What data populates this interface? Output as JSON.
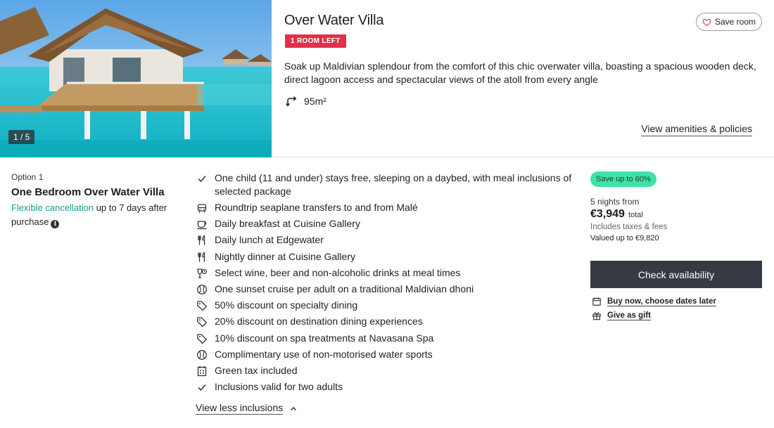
{
  "room": {
    "title": "Over Water Villa",
    "badge": "1 ROOM LEFT",
    "save_label": "Save room",
    "description": "Soak up Maldivian splendour from the comfort of this chic overwater villa, boasting a spacious wooden deck, direct lagoon access and spectacular views of the atoll from every angle",
    "size": "95m²",
    "view_amenities": "View amenities & policies",
    "image_counter": "1 / 5"
  },
  "option": {
    "label": "Option 1",
    "name": "One Bedroom Over Water Villa",
    "flex_link": "Flexible cancellation",
    "flex_rest": " up to 7 days after purchase"
  },
  "inclusions": [
    {
      "icon": "check-icon",
      "text": "One child (11 and under) stays free, sleeping on a daybed, with meal inclusions of selected package"
    },
    {
      "icon": "transfer-icon",
      "text": "Roundtrip seaplane transfers to and from Malé"
    },
    {
      "icon": "breakfast-icon",
      "text": "Daily breakfast at Cuisine Gallery"
    },
    {
      "icon": "cutlery-icon",
      "text": "Daily lunch at Edgewater"
    },
    {
      "icon": "cutlery-icon",
      "text": "Nightly dinner at Cuisine Gallery"
    },
    {
      "icon": "drinks-icon",
      "text": "Select wine, beer and non-alcoholic drinks at meal times"
    },
    {
      "icon": "activity-icon",
      "text": "One sunset cruise per adult on a traditional Maldivian dhoni"
    },
    {
      "icon": "tag-icon",
      "text": "50% discount on specialty dining"
    },
    {
      "icon": "tag-icon",
      "text": "20% discount on destination dining experiences"
    },
    {
      "icon": "tag-icon",
      "text": "10% discount on spa treatments at Navasana Spa"
    },
    {
      "icon": "activity-icon",
      "text": "Complimentary use of non-motorised water sports"
    },
    {
      "icon": "tax-icon",
      "text": "Green tax included"
    },
    {
      "icon": "check-icon",
      "text": "Inclusions valid for two adults"
    }
  ],
  "view_less": "View less inclusions",
  "pricing": {
    "save_pill": "Save up to 60%",
    "nights": "5 nights from",
    "price": "€3,949",
    "total": "total",
    "taxes": "Includes taxes & fees",
    "valued": "Valued up to €9,820",
    "check_button": "Check availability",
    "buy_now": "Buy now, choose dates later",
    "give_gift": "Give as gift"
  },
  "colors": {
    "badge": "#e0304a",
    "save_pill": "#3de3a6",
    "flex_link": "#1a9a8a",
    "button": "#363b43"
  }
}
